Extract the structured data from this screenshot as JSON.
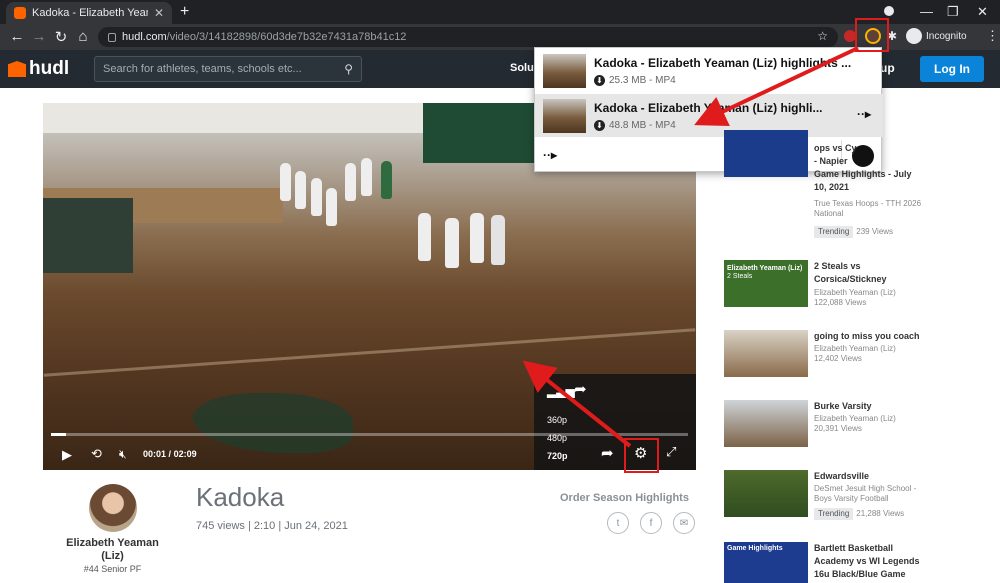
{
  "browser": {
    "tab_title": "Kadoka - Elizabeth Yeaman (Liz) |",
    "url_host": "hudl.com",
    "url_path": "/video/3/14182898/60d3de7b32e7431a78b41c12",
    "incognito_label": "Incognito"
  },
  "hudl": {
    "logo_text": "hudl",
    "search_placeholder": "Search for athletes, teams, schools etc...",
    "nav_solutions": "Solut",
    "signup_label": "up",
    "login_label": "Log In"
  },
  "video": {
    "time_current": "00:01",
    "time_sep": "/",
    "time_total": "02:09",
    "progress_fraction": 0.008,
    "quality_options": [
      "360p",
      "480p",
      "720p"
    ],
    "selected_quality": "720p"
  },
  "download_popup": {
    "items": [
      {
        "title": "Kadoka - Elizabeth Yeaman (Liz) highlights ...",
        "size": "25.3 MB - MP4"
      },
      {
        "title": "Kadoka - Elizabeth Yeaman (Liz) highli...",
        "size": "48.8 MB - MP4"
      }
    ]
  },
  "info": {
    "title": "Kadoka",
    "meta": "745 views | 2:10 | Jun 24, 2021",
    "order_label": "Order Season Highlights"
  },
  "athlete": {
    "name": "Elizabeth Yeaman (Liz)",
    "sub": "#44 Senior PF"
  },
  "sidebar": [
    {
      "title_lines": [
        "ops vs Cy",
        "- Napier",
        "Game Highlights - July",
        "10, 2021"
      ],
      "sub": "True Texas Hoops - TTH 2026 National",
      "trending": "Trending",
      "views": "239 Views"
    },
    {
      "title_lines": [
        "2 Steals vs",
        "Corsica/Stickney"
      ],
      "sub": "Elizabeth Yeaman (Liz)",
      "views": "122,088 Views",
      "thumb_text": "Elizabeth Yeaman (Liz)",
      "thumb_text2": "2 Steals"
    },
    {
      "title_lines": [
        "going to miss you coach"
      ],
      "sub": "Elizabeth Yeaman (Liz)",
      "views": "12,402 Views"
    },
    {
      "title_lines": [
        "Burke Varsity"
      ],
      "sub": "Elizabeth Yeaman (Liz)",
      "views": "20,391 Views"
    },
    {
      "title_lines": [
        "Edwardsville"
      ],
      "sub": "DeSmet Jesuit High School - Boys Varsity Football",
      "trending": "Trending",
      "views": "21,288 Views"
    },
    {
      "title_lines": [
        "Bartlett Basketball",
        "Academy vs WI Legends",
        "16u Black/Blue Game"
      ],
      "thumb_text": "Game Highlights"
    }
  ],
  "colors": {
    "accent": "#ff6300",
    "login_blue": "#0b83d9",
    "annotation_red": "#e01b1b"
  }
}
